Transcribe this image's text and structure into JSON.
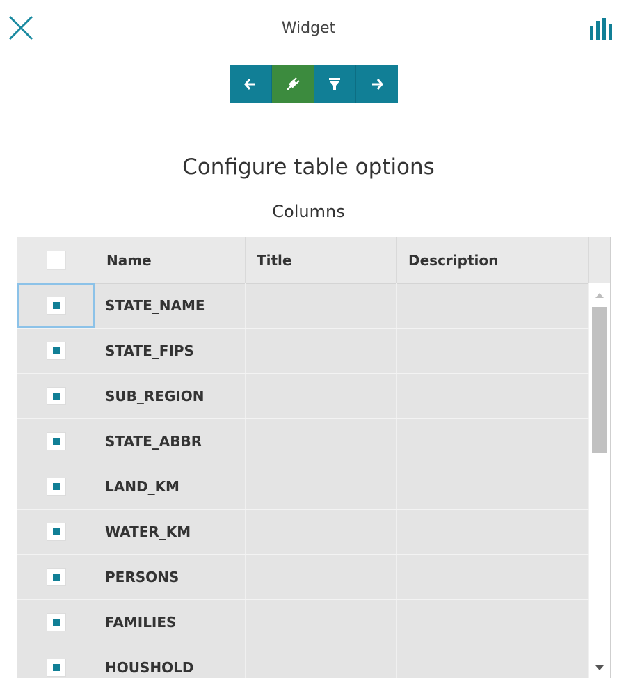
{
  "window": {
    "title": "Widget"
  },
  "icons": {
    "close": "close-icon",
    "chart": "bar-chart-icon"
  },
  "toolbar": {
    "buttons": [
      {
        "name": "back",
        "icon": "arrow-left-icon",
        "active": false
      },
      {
        "name": "connect",
        "icon": "plug-icon",
        "active": true
      },
      {
        "name": "filter",
        "icon": "filter-icon",
        "active": false
      },
      {
        "name": "next",
        "icon": "arrow-right-icon",
        "active": false
      }
    ],
    "colors": {
      "normal": "#117f96",
      "active": "#3c8b3e"
    }
  },
  "page": {
    "heading": "Configure table options",
    "subheading": "Columns"
  },
  "table": {
    "headers": {
      "name": "Name",
      "title": "Title",
      "description": "Description"
    },
    "select_all_checked": false,
    "rows": [
      {
        "name": "STATE_NAME",
        "title": "",
        "description": "",
        "checked": true,
        "selected": true
      },
      {
        "name": "STATE_FIPS",
        "title": "",
        "description": "",
        "checked": true
      },
      {
        "name": "SUB_REGION",
        "title": "",
        "description": "",
        "checked": true
      },
      {
        "name": "STATE_ABBR",
        "title": "",
        "description": "",
        "checked": true
      },
      {
        "name": "LAND_KM",
        "title": "",
        "description": "",
        "checked": true
      },
      {
        "name": "WATER_KM",
        "title": "",
        "description": "",
        "checked": true
      },
      {
        "name": "PERSONS",
        "title": "",
        "description": "",
        "checked": true
      },
      {
        "name": "FAMILIES",
        "title": "",
        "description": "",
        "checked": true
      },
      {
        "name": "HOUSHOLD",
        "title": "",
        "description": "",
        "checked": true
      }
    ]
  },
  "colors": {
    "accent": "#117f96",
    "active": "#3c8b3e",
    "row_bg": "#e4e4e4"
  }
}
